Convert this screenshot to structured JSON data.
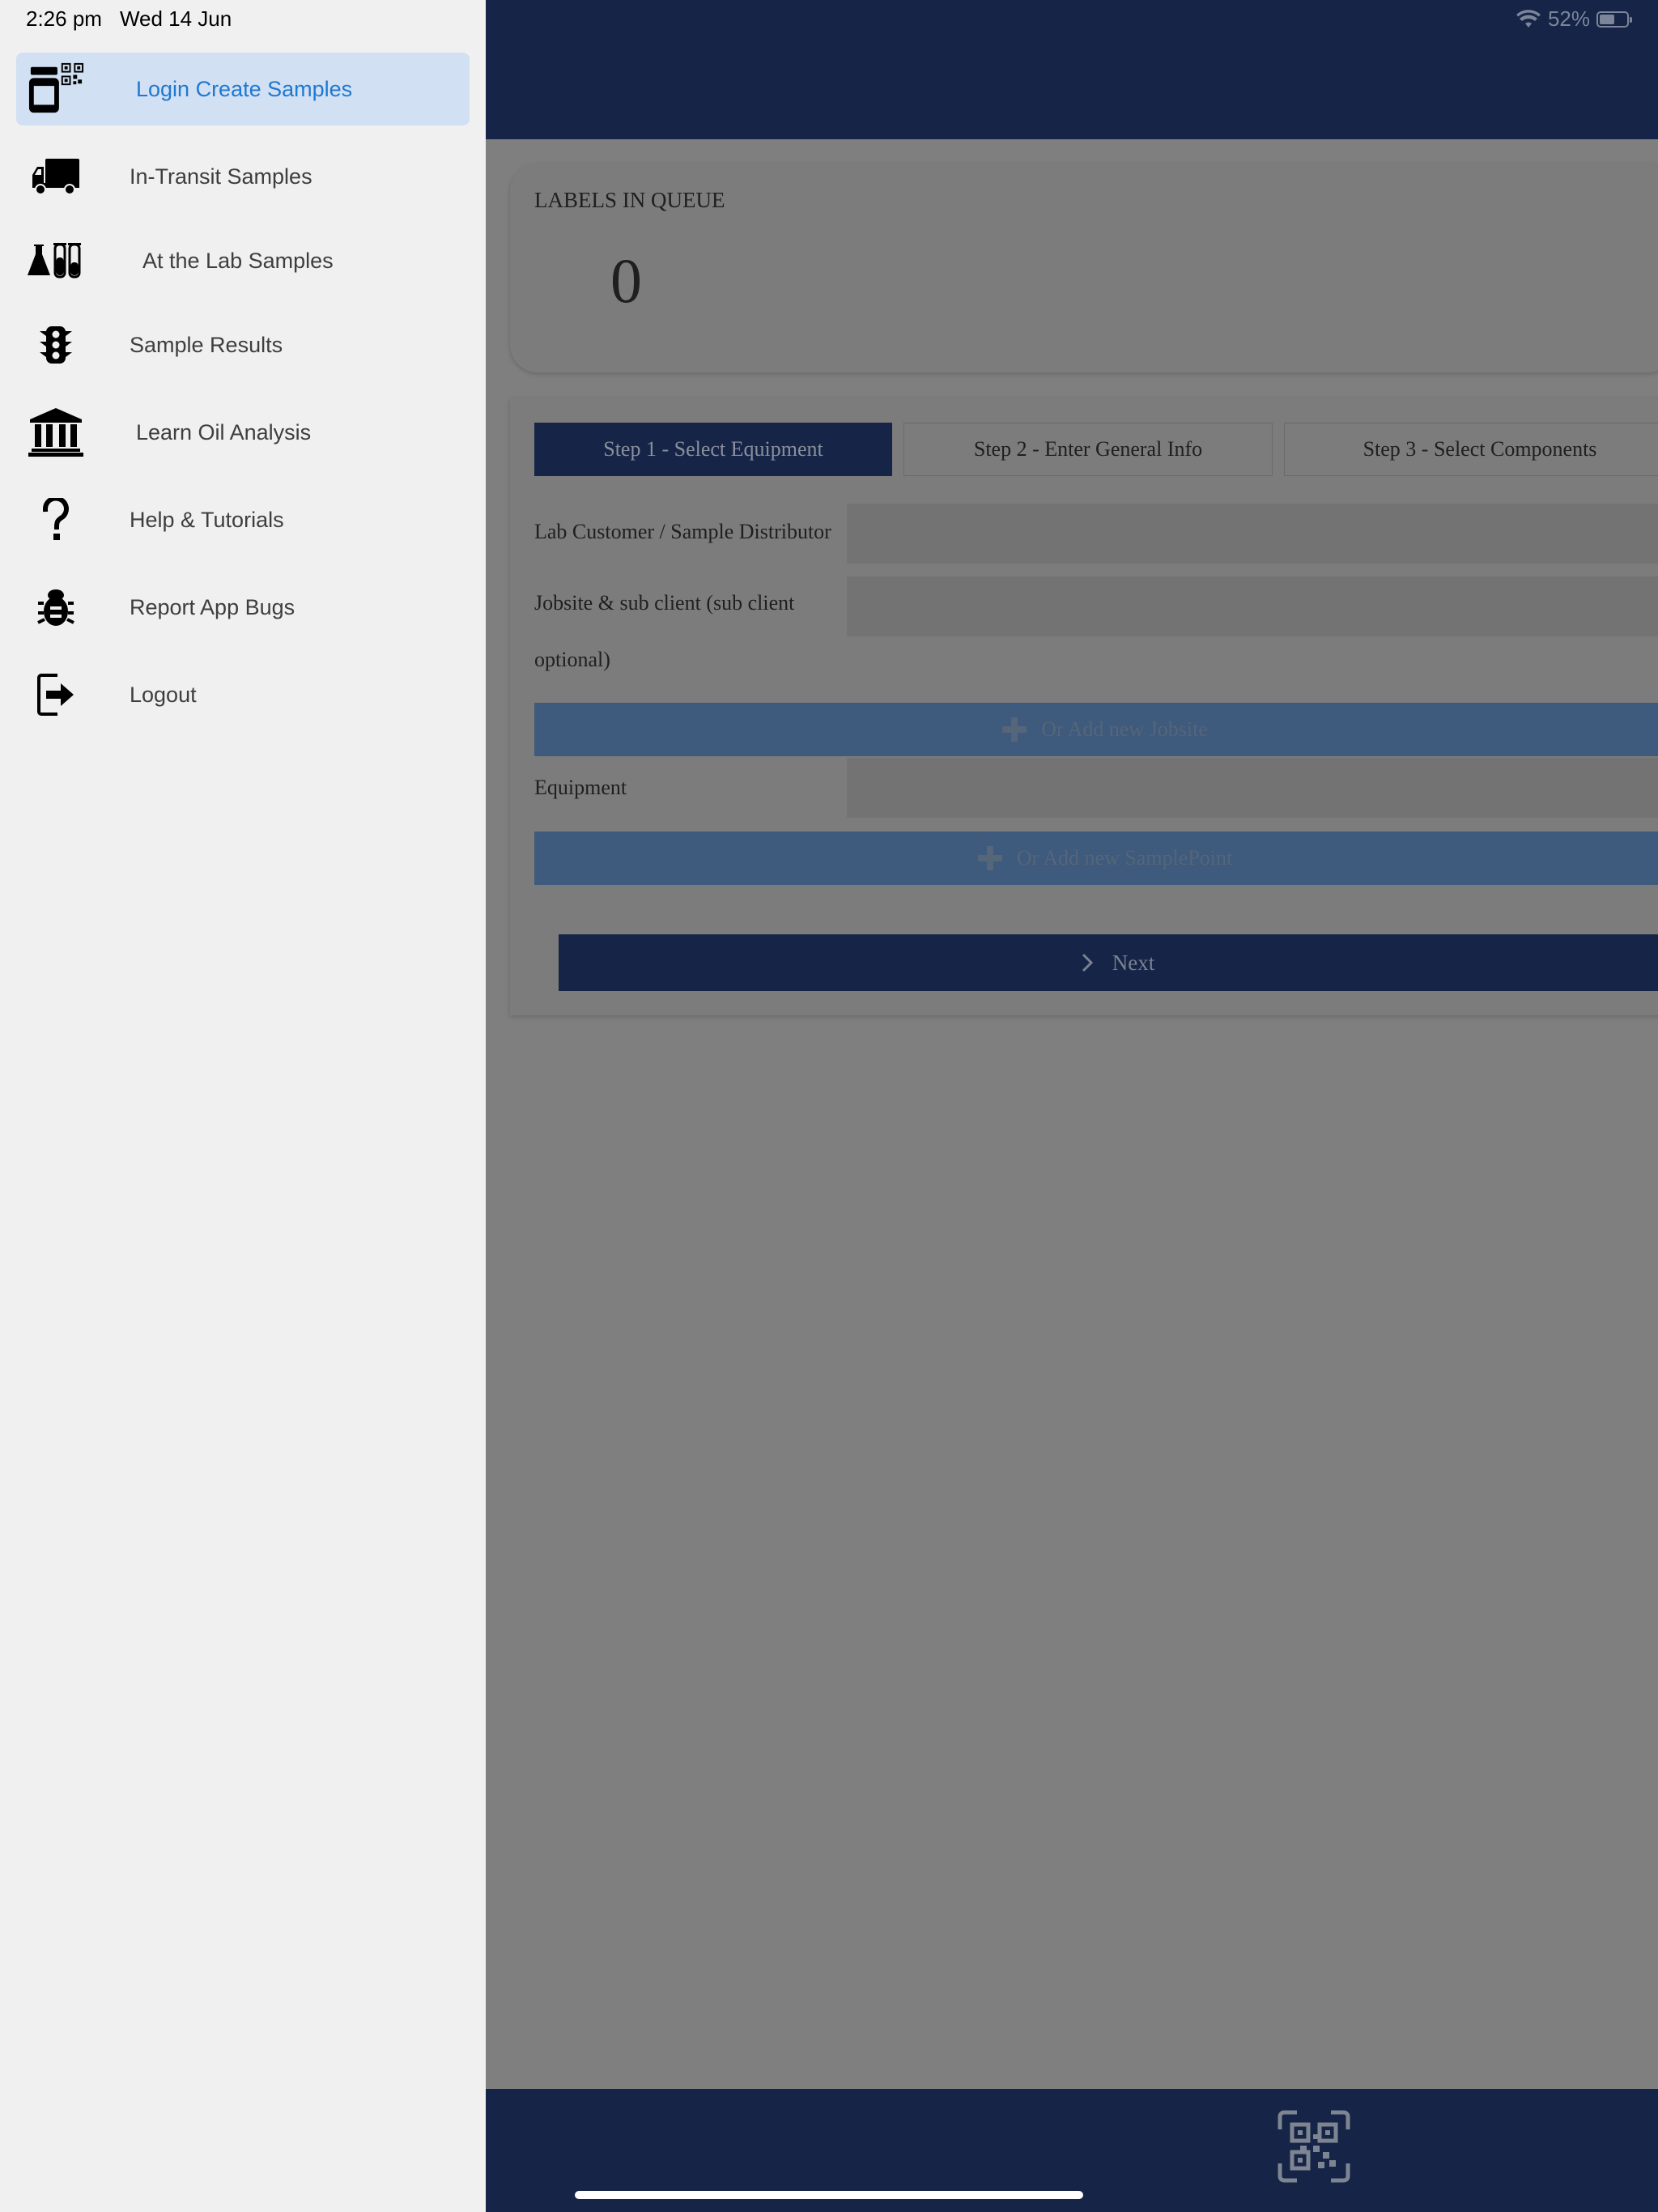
{
  "status_bar": {
    "time": "2:26 pm",
    "date": "Wed 14 Jun",
    "battery": "52%",
    "wifi_icon": "wifi-icon",
    "battery_icon": "battery-icon"
  },
  "drawer": {
    "items": [
      {
        "label": "Login Create Samples",
        "icon": "bottle-qr-icon",
        "active": true
      },
      {
        "label": "In-Transit Samples",
        "icon": "truck-icon"
      },
      {
        "label": "At the Lab Samples",
        "icon": "lab-flask-icon"
      },
      {
        "label": "Sample Results",
        "icon": "traffic-light-icon"
      },
      {
        "label": "Learn Oil Analysis",
        "icon": "institution-icon"
      },
      {
        "label": "Help & Tutorials",
        "icon": "question-icon"
      },
      {
        "label": "Report App Bugs",
        "icon": "bug-icon"
      },
      {
        "label": "Logout",
        "icon": "logout-icon"
      }
    ]
  },
  "queue": {
    "title": "LABELS IN QUEUE",
    "count": "0"
  },
  "steps": [
    {
      "label": "Step 1 - Select Equipment",
      "active": true
    },
    {
      "label": "Step 2 - Enter General Info"
    },
    {
      "label": "Step 3 - Select Components"
    }
  ],
  "form": {
    "customer_label": "Lab Customer / Sample Distributor",
    "customer_value": "",
    "jobsite_label": "Jobsite & sub client (sub client optional)",
    "jobsite_value": "",
    "add_jobsite": "Or Add new Jobsite",
    "equipment_label": "Equipment",
    "equipment_value": "",
    "add_samplepoint": "Or Add new SamplePoint",
    "next_label": "Next"
  },
  "colors": {
    "navy": "#152447",
    "drawer_bg": "#f0f0f0",
    "active_item_bg": "#d1e0f2",
    "active_item_text": "#1f78d1"
  }
}
